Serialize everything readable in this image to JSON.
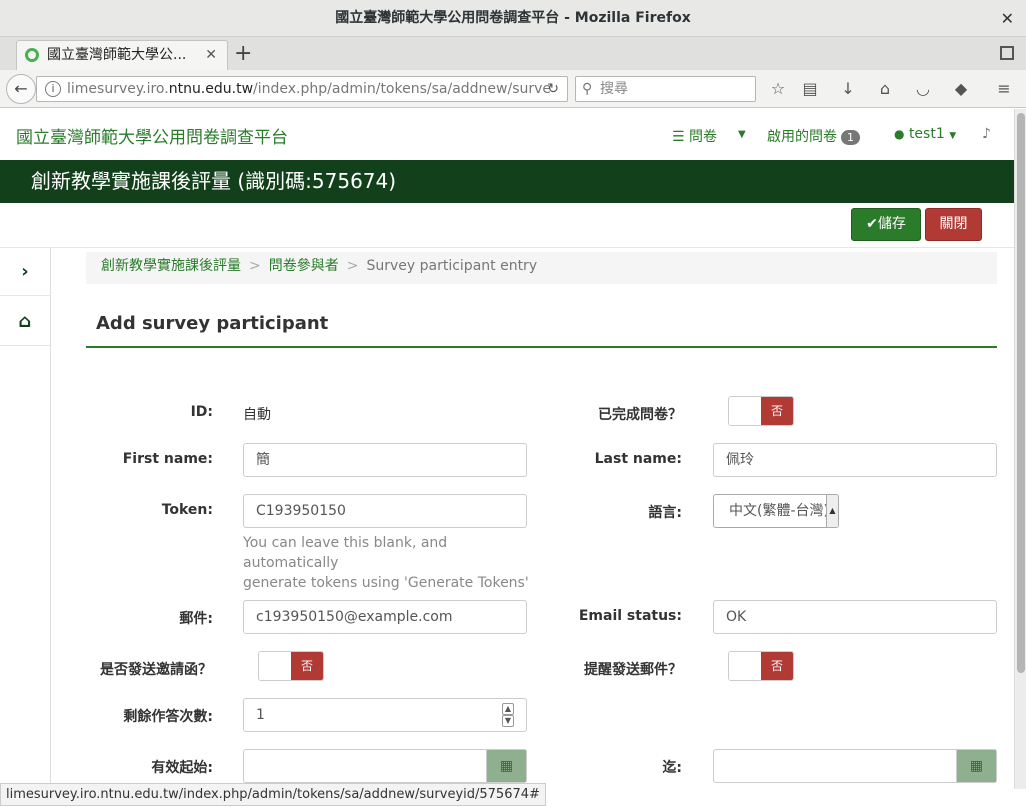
{
  "browser": {
    "window_title": "國立臺灣師範大學公用問卷調查平台 - Mozilla Firefox",
    "tab_title": "國立臺灣師範大學公...",
    "url_prefix": "limesurvey.iro.",
    "url_domain": "ntnu.edu.tw",
    "url_path": "/index.php/admin/tokens/sa/addnew/surve",
    "search_placeholder": "搜尋",
    "status_url": "limesurvey.iro.ntnu.edu.tw/index.php/admin/tokens/sa/addnew/surveyid/575674#"
  },
  "header": {
    "brand": "國立臺灣師範大學公用問卷調查平台",
    "menu_surveys": "問卷",
    "active_surveys": "啟用的問卷",
    "active_count": "1",
    "user": "test1"
  },
  "banner": {
    "title": "創新教學實施課後評量 (識別碼:575674)"
  },
  "actions": {
    "save": "儲存",
    "close": "關閉"
  },
  "breadcrumb": {
    "survey": "創新教學實施課後評量",
    "participants": "問卷參與者",
    "current": "Survey participant entry",
    "sep": ">"
  },
  "form": {
    "title": "Add survey participant",
    "id_label": "ID:",
    "id_value": "自動",
    "completed_label": "已完成問卷？",
    "first_name_label": "First name:",
    "first_name_value": "簡",
    "last_name_label": "Last name:",
    "last_name_value": "佩玲",
    "token_label": "Token:",
    "token_value": "C193950150",
    "token_help_1": "You can leave this blank, and automatically",
    "token_help_2": "generate tokens using 'Generate Tokens'",
    "language_label": "語言:",
    "language_value": "中文(繁體-台灣)",
    "email_label": "郵件:",
    "email_value": "c193950150@example.com",
    "email_status_label": "Email status:",
    "email_status_value": "OK",
    "invite_label": "是否發送邀請函？",
    "reminder_label": "提醒發送郵件？",
    "uses_left_label": "剩餘作答次數:",
    "uses_left_value": "1",
    "valid_from_label": "有效起始:",
    "valid_until_label": "迄:",
    "toggle_no": "否"
  },
  "icons": {
    "back": "arrow-left-icon",
    "info": "info-icon",
    "reload": "reload-icon",
    "search": "search-icon",
    "bookmark": "star-icon",
    "reader": "reader-icon",
    "download": "download-icon",
    "home": "home-icon",
    "pocket": "pocket-icon",
    "menu": "hamburger-icon",
    "calendar": "calendar-icon",
    "check": "check-icon"
  }
}
